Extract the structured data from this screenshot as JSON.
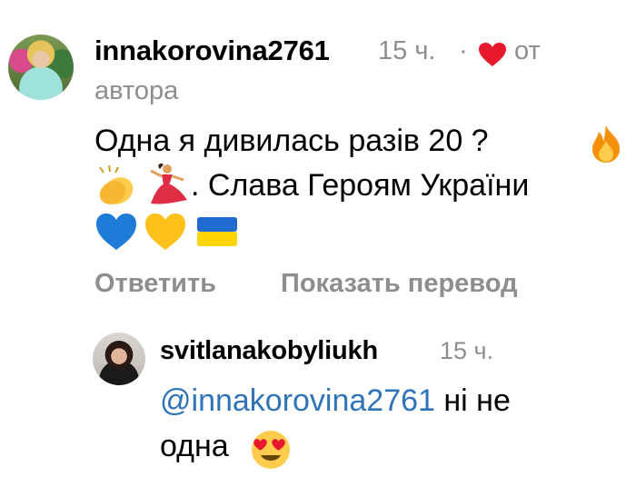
{
  "comment": {
    "username": "innakorovina2761",
    "time": "15 ч.",
    "separator": "·",
    "liked_by_author_prefix": "от",
    "liked_by_author_suffix": "автора",
    "text_line1": "Одна я дивилась разів 20 ?",
    "text_line2": ". Слава Героям України",
    "emoji": [
      "fire",
      "clapping-hands",
      "dancer",
      "blue-heart",
      "yellow-heart",
      "ukraine-flag"
    ],
    "reply_label": "Ответить",
    "translate_label": "Показать перевод"
  },
  "reply": {
    "username": "svitlanakobyliukh",
    "time": "15 ч.",
    "mention": "@innakorovina2761",
    "text_after_mention": "ні не",
    "text_line2": "одна",
    "emoji": [
      "smiling-face-with-heart-eyes"
    ]
  },
  "colors": {
    "heart": "#e8192c",
    "mention": "#2f73b9",
    "muted": "#8e8e8e"
  }
}
